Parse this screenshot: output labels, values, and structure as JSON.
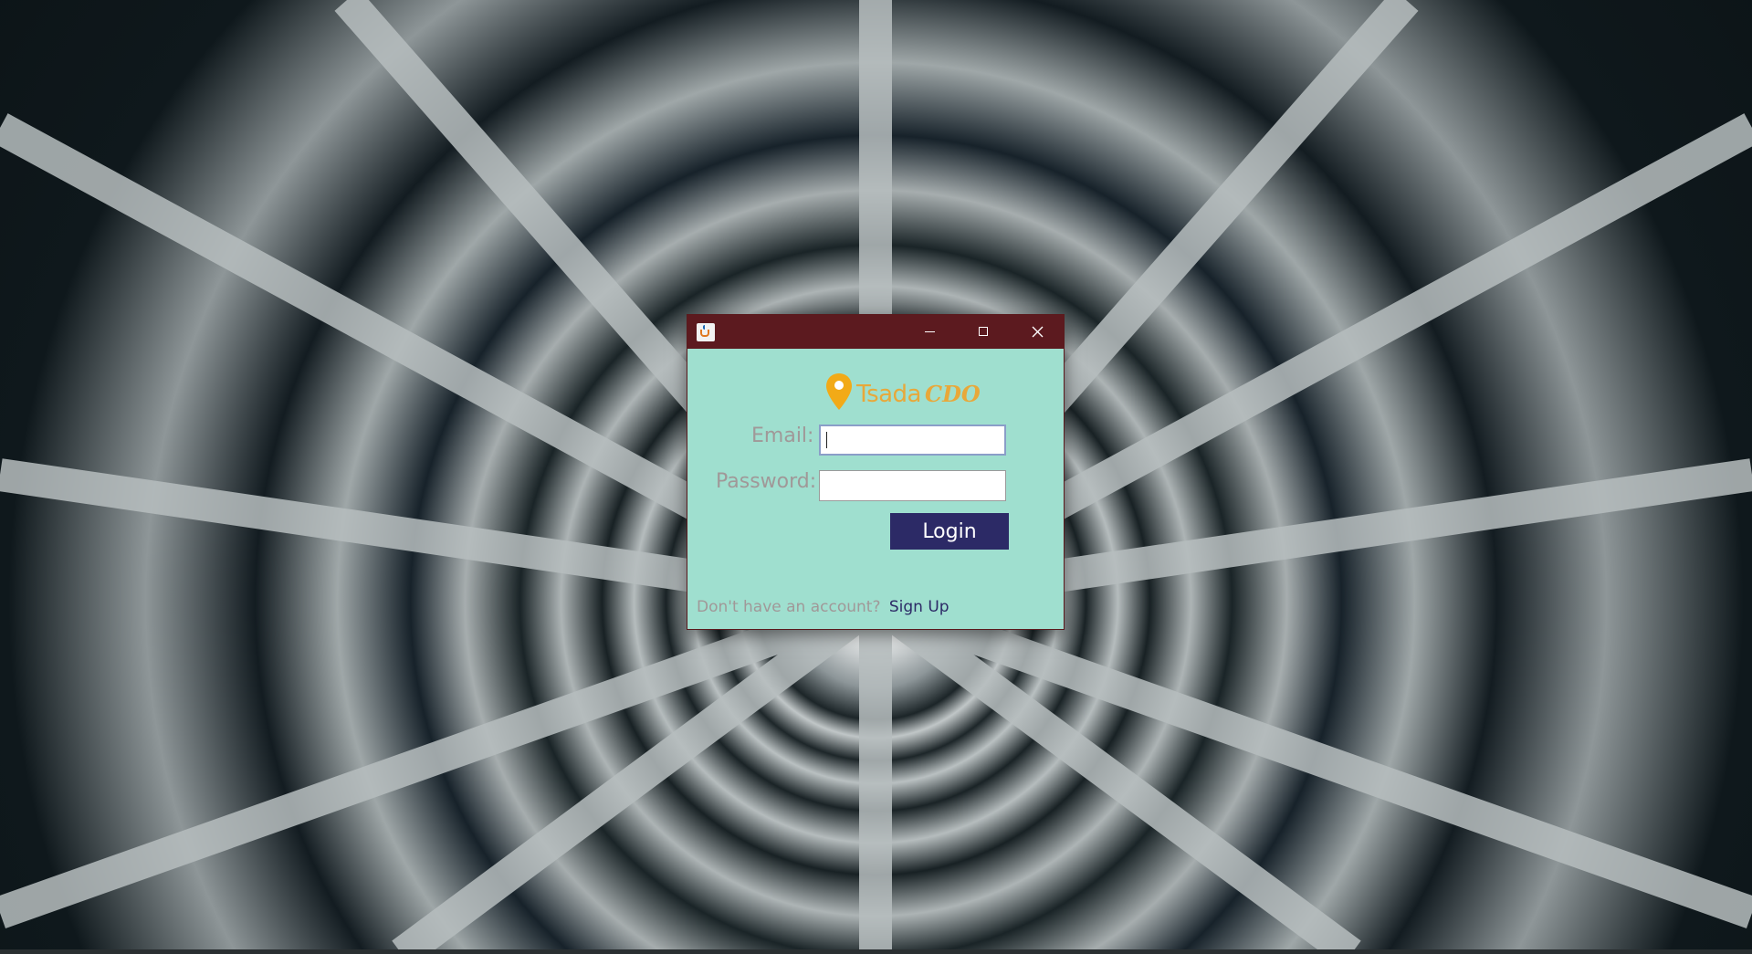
{
  "window": {
    "title": "",
    "controls": {
      "minimize": "minimize",
      "maximize": "maximize",
      "close": "close"
    }
  },
  "logo": {
    "text": "Tsada",
    "script_text": "CDO",
    "icon": "map-pin-icon",
    "color": "#e8a83a"
  },
  "form": {
    "email_label": "Email:",
    "email_value": "",
    "password_label": "Password:",
    "password_value": "",
    "login_label": "Login"
  },
  "signup": {
    "prompt": "Don't have an account?",
    "link": "Sign Up"
  },
  "colors": {
    "title_bar": "#5c1a1f",
    "panel": "#9fdfcf",
    "button": "#2c2a66",
    "label": "#a09898"
  }
}
